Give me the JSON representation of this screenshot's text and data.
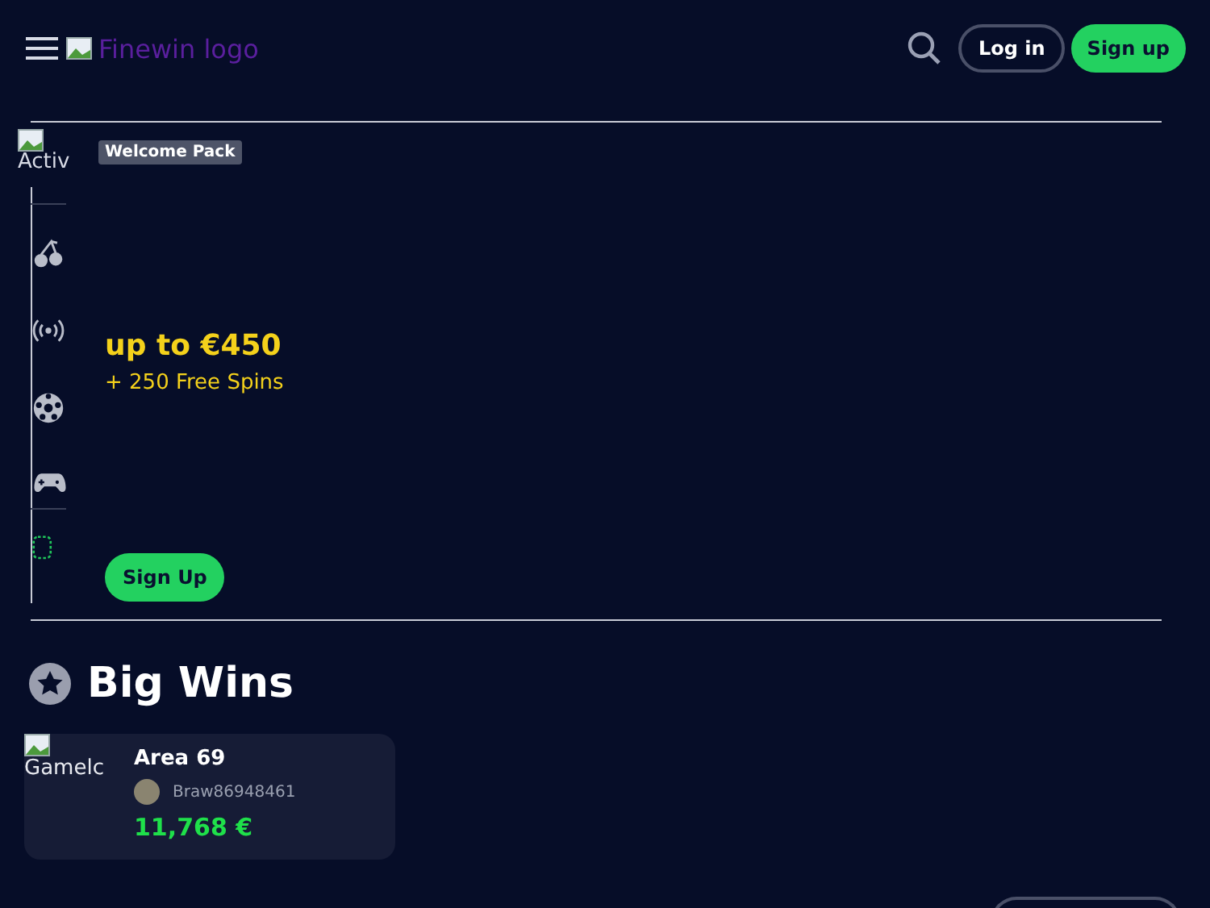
{
  "header": {
    "logo_alt": "Finewin logo",
    "buttons": [
      {
        "label": "Log in",
        "kind": "outline"
      },
      {
        "label": "Sign up",
        "kind": "filled"
      }
    ]
  },
  "sidebar": {
    "image_alt": "Activ"
  },
  "promo": {
    "badge": "Welcome Pack",
    "headline": "up to €450",
    "subline": "+ 250 Free Spins",
    "button": "Sign Up"
  },
  "big_wins": {
    "title": "Big Wins",
    "cards": [
      {
        "image_alt": "Gamelc",
        "game": "Area 69",
        "player": "Braw86948461",
        "amount": "11,768 €"
      }
    ]
  }
}
